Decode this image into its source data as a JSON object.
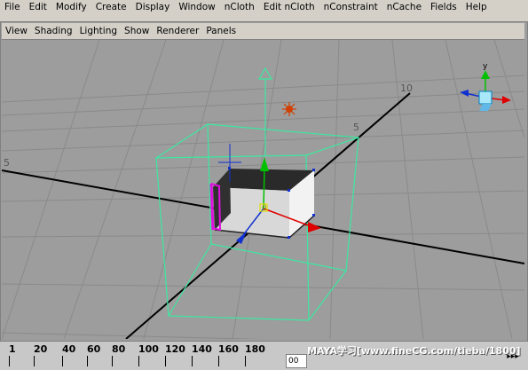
{
  "menubar": {
    "items": [
      "File",
      "Edit",
      "Modify",
      "Create",
      "Display",
      "Window",
      "nCloth",
      "Edit nCloth",
      "nConstraint",
      "nCache",
      "Fields",
      "Help"
    ]
  },
  "panel_menu": {
    "items": [
      "View",
      "Shading",
      "Lighting",
      "Show",
      "Renderer",
      "Panels"
    ]
  },
  "viewport": {
    "grid_labels": {
      "left": "5",
      "top_right": "10",
      "right_mid": "5"
    },
    "view_cube_label": "y",
    "manipulator_label": "0"
  },
  "timeline": {
    "ticks": [
      "1",
      "20",
      "40",
      "60",
      "80",
      "100",
      "120",
      "140",
      "160",
      "180"
    ],
    "frame_value": "00",
    "watermark": "MAYA学习[www.fineCG.com/tieba/1800]",
    "play_label": "▸▸▸"
  },
  "colors": {
    "viewport_bg": "#9d9d9d",
    "grid": "#808080",
    "axis": "#000000",
    "bbox": "#3be8a0",
    "handle_red": "#e00000",
    "handle_green": "#00c000",
    "handle_blue": "#1030d0",
    "selection_magenta": "#e010e0"
  }
}
